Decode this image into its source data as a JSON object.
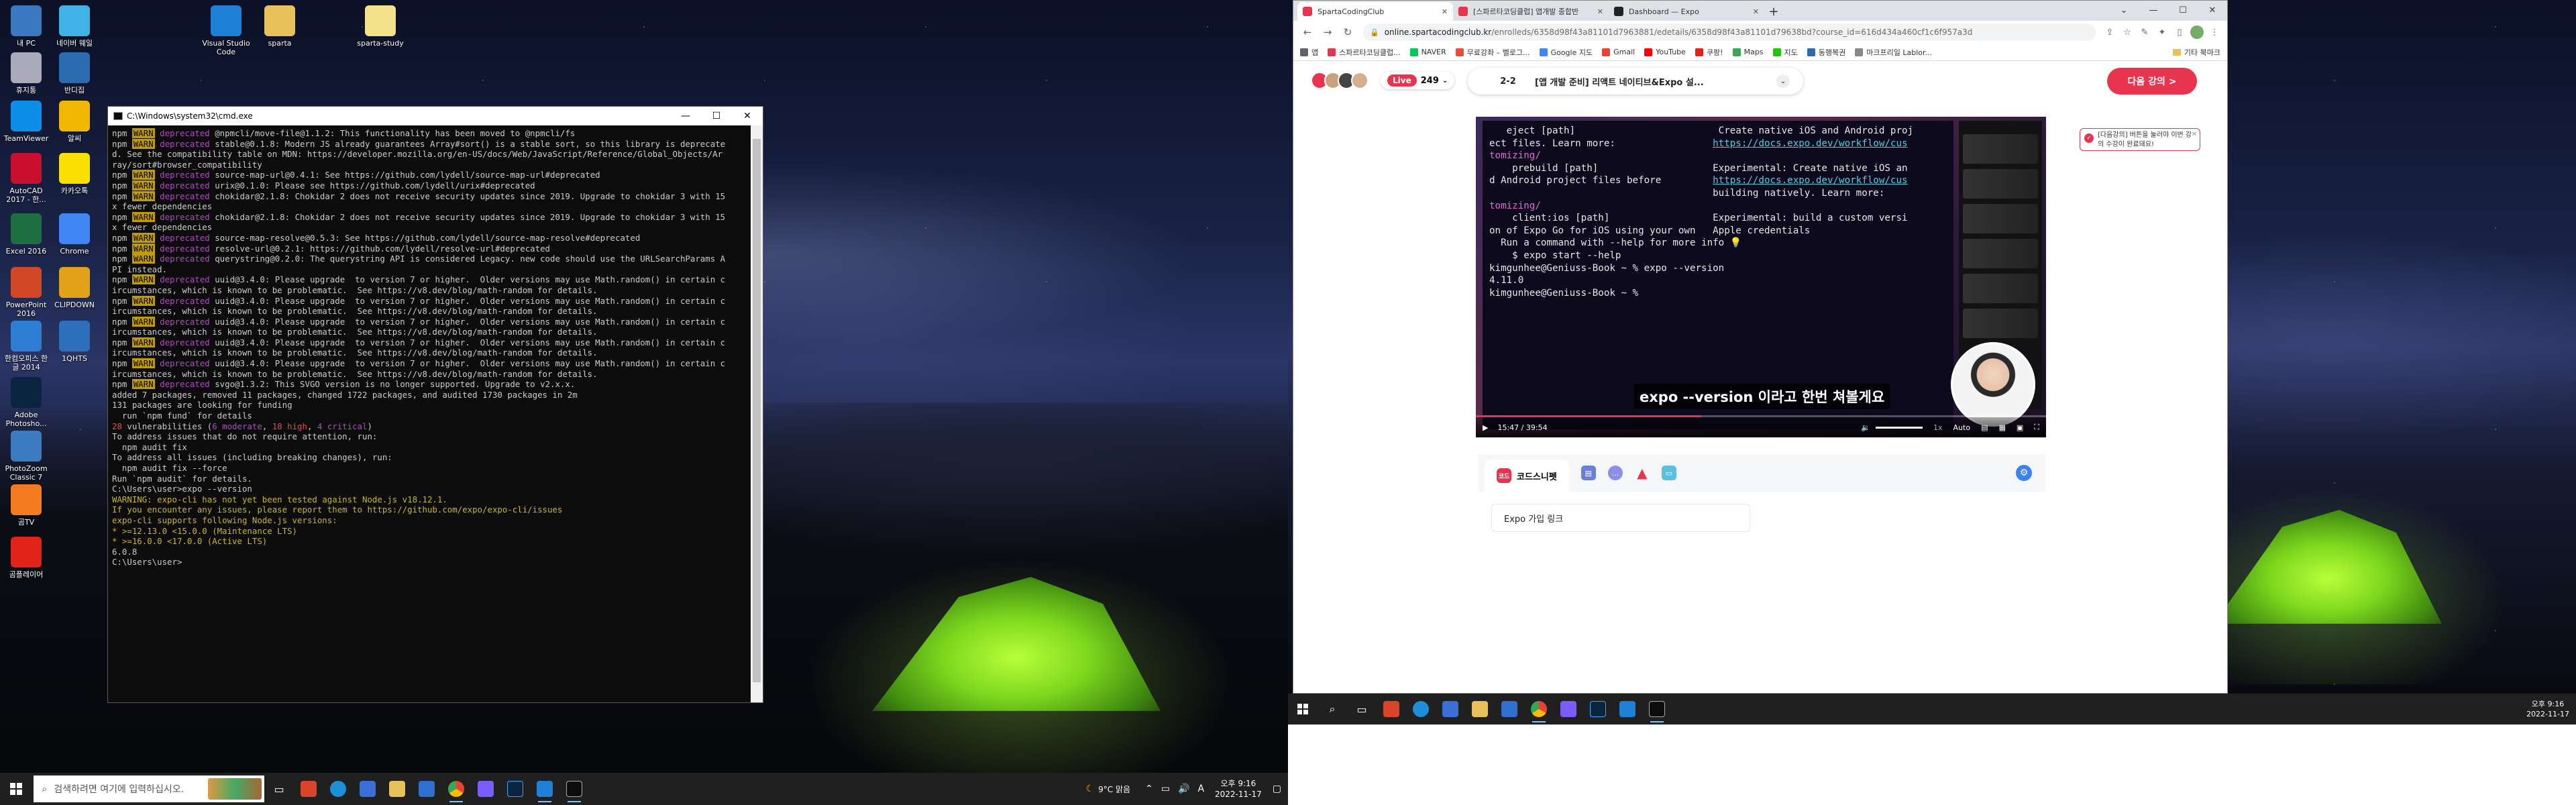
{
  "desktop_icons": [
    {
      "label": "내 PC",
      "icon": "pc-icon",
      "color": "#3a78c2"
    },
    {
      "label": "네이버 웨일",
      "icon": "whale-icon",
      "color": "#3fb3e6"
    },
    {
      "label": "Visual Studio Code",
      "icon": "vscode-icon",
      "color": "#1e7fd6"
    },
    {
      "label": "sparta",
      "icon": "folder-icon",
      "color": "#e8c15a"
    },
    {
      "label": "sparta-study",
      "icon": "file-icon",
      "color": "#f3e28a"
    },
    {
      "label": "휴지통",
      "icon": "recycle-bin-icon",
      "color": "#aab"
    },
    {
      "label": "반디집",
      "icon": "bandizip-icon",
      "color": "#2b6cb0"
    },
    {
      "label": "TeamViewer",
      "icon": "teamviewer-icon",
      "color": "#0e8ee9"
    },
    {
      "label": "알씨",
      "icon": "alsee-icon",
      "color": "#f2b705"
    },
    {
      "label": "AutoCAD 2017 - 한...",
      "icon": "autocad-icon",
      "color": "#c8102e"
    },
    {
      "label": "카카오톡",
      "icon": "kakaotalk-icon",
      "color": "#f9e000"
    },
    {
      "label": "Excel 2016",
      "icon": "excel-icon",
      "color": "#1d6f42"
    },
    {
      "label": "Chrome",
      "icon": "chrome-icon",
      "color": "#4285f4"
    },
    {
      "label": "PowerPoint 2016",
      "icon": "powerpoint-icon",
      "color": "#d24726"
    },
    {
      "label": "CLIPDOWN",
      "icon": "clipdown-icon",
      "color": "#e2a21a"
    },
    {
      "label": "한컴오피스 한글 2014",
      "icon": "hwp-icon",
      "color": "#2d7dd2"
    },
    {
      "label": "1QHTS",
      "icon": "qhts-icon",
      "color": "#2c6fbb"
    },
    {
      "label": "Adobe Photosho...",
      "icon": "photoshop-icon",
      "color": "#0b2540"
    },
    {
      "label": "PhotoZoom Classic 7",
      "icon": "photozoom-icon",
      "color": "#3b7bbf"
    },
    {
      "label": "곰TV",
      "icon": "gomtv-icon",
      "color": "#f47b20"
    },
    {
      "label": "곰플레이어",
      "icon": "gomplayer-icon",
      "color": "#e2231a"
    }
  ],
  "cmd": {
    "title": "C:\\Windows\\system32\\cmd.exe",
    "lines": [
      {
        "t": "npm WARN deprecated @npmcli/move-file@1.1.2: This functionality has been moved to @npmcli/fs",
        "c": "warn"
      },
      {
        "t": "npm WARN deprecated stable@0.1.8: Modern JS already guarantees Array#sort() is a stable sort, so this library is deprecated. See the compatibility table on MDN: https://developer.mozilla.org/en-US/docs/Web/JavaScript/Reference/Global_Objects/Array/sort#browser_compatibility",
        "c": "warn"
      },
      {
        "t": "npm WARN deprecated source-map-url@0.4.1: See https://github.com/lydell/source-map-url#deprecated",
        "c": "warn"
      },
      {
        "t": "npm WARN deprecated urix@0.1.0: Please see https://github.com/lydell/urix#deprecated",
        "c": "warn"
      },
      {
        "t": "npm WARN deprecated chokidar@2.1.8: Chokidar 2 does not receive security updates since 2019. Upgrade to chokidar 3 with 15x fewer dependencies",
        "c": "warn"
      },
      {
        "t": "npm WARN deprecated chokidar@2.1.8: Chokidar 2 does not receive security updates since 2019. Upgrade to chokidar 3 with 15x fewer dependencies",
        "c": "warn"
      },
      {
        "t": "npm WARN deprecated source-map-resolve@0.5.3: See https://github.com/lydell/source-map-resolve#deprecated",
        "c": "warn"
      },
      {
        "t": "npm WARN deprecated resolve-url@0.2.1: https://github.com/lydell/resolve-url#deprecated",
        "c": "warn"
      },
      {
        "t": "npm WARN deprecated querystring@0.2.0: The querystring API is considered Legacy. new code should use the URLSearchParams API instead.",
        "c": "warn"
      },
      {
        "t": "npm WARN deprecated uuid@3.4.0: Please upgrade  to version 7 or higher.  Older versions may use Math.random() in certain circumstances, which is known to be problematic.  See https://v8.dev/blog/math-random for details.",
        "c": "warn"
      },
      {
        "t": "npm WARN deprecated uuid@3.4.0: Please upgrade  to version 7 or higher.  Older versions may use Math.random() in certain circumstances, which is known to be problematic.  See https://v8.dev/blog/math-random for details.",
        "c": "warn"
      },
      {
        "t": "npm WARN deprecated uuid@3.4.0: Please upgrade  to version 7 or higher.  Older versions may use Math.random() in certain circumstances, which is known to be problematic.  See https://v8.dev/blog/math-random for details.",
        "c": "warn"
      },
      {
        "t": "npm WARN deprecated uuid@3.4.0: Please upgrade  to version 7 or higher.  Older versions may use Math.random() in certain circumstances, which is known to be problematic.  See https://v8.dev/blog/math-random for details.",
        "c": "warn"
      },
      {
        "t": "npm WARN deprecated uuid@3.4.0: Please upgrade  to version 7 or higher.  Older versions may use Math.random() in certain circumstances, which is known to be problematic.  See https://v8.dev/blog/math-random for details.",
        "c": "warn"
      },
      {
        "t": "npm WARN deprecated svgo@1.3.2: This SVGO version is no longer supported. Upgrade to v2.x.x.",
        "c": "warn"
      },
      {
        "t": "",
        "c": "plain"
      },
      {
        "t": "added 7 packages, removed 11 packages, changed 1722 packages, and audited 1730 packages in 2m",
        "c": "plain"
      },
      {
        "t": "",
        "c": "plain"
      },
      {
        "t": "131 packages are looking for funding",
        "c": "plain"
      },
      {
        "t": "  run `npm fund` for details",
        "c": "plain"
      },
      {
        "t": "",
        "c": "plain"
      },
      {
        "t": "28 vulnerabilities (6 moderate, 18 high, 4 critical)",
        "c": "vuln"
      },
      {
        "t": "",
        "c": "plain"
      },
      {
        "t": "To address issues that do not require attention, run:",
        "c": "plain"
      },
      {
        "t": "  npm audit fix",
        "c": "plain"
      },
      {
        "t": "",
        "c": "plain"
      },
      {
        "t": "To address all issues (including breaking changes), run:",
        "c": "plain"
      },
      {
        "t": "  npm audit fix --force",
        "c": "plain"
      },
      {
        "t": "",
        "c": "plain"
      },
      {
        "t": "Run `npm audit` for details.",
        "c": "plain"
      },
      {
        "t": "",
        "c": "plain"
      },
      {
        "t": "C:\\Users\\user>expo --version",
        "c": "plain"
      },
      {
        "t": "WARNING: expo-cli has not yet been tested against Node.js v18.12.1.",
        "c": "yellow"
      },
      {
        "t": "If you encounter any issues, please report them to https://github.com/expo/expo-cli/issues",
        "c": "yellow"
      },
      {
        "t": "",
        "c": "plain"
      },
      {
        "t": "expo-cli supports following Node.js versions:",
        "c": "yellow"
      },
      {
        "t": "* >=12.13.0 <15.0.0 (Maintenance LTS)",
        "c": "yellow"
      },
      {
        "t": "* >=16.0.0 <17.0.0 (Active LTS)",
        "c": "yellow"
      },
      {
        "t": "",
        "c": "plain"
      },
      {
        "t": "6.0.8",
        "c": "plain"
      },
      {
        "t": "",
        "c": "plain"
      },
      {
        "t": "C:\\Users\\user>",
        "c": "plain"
      }
    ]
  },
  "taskbar1": {
    "search_placeholder": "검색하려면 여기에 입력하십시오.",
    "weather": "9°C 맑음",
    "time": "오후 9:16",
    "date": "2022-11-17",
    "ime": "A"
  },
  "browser": {
    "tabs": [
      {
        "label": "SpartaCodingClub",
        "color": "#e8344e",
        "active": true
      },
      {
        "label": "[스파르타코딩클럽] 앱개발 종합반",
        "color": "#e8344e",
        "active": false
      },
      {
        "label": "Dashboard — Expo",
        "color": "#222222",
        "active": false
      }
    ],
    "url_host": "online.spartacodingclub.kr",
    "url_path": "/enrolleds/6358d98f43a81101d7963881/edetails/6358d98f43a81101d79638bd?course_id=616d434a460cf1c6f957a3d",
    "bookmarks": [
      {
        "label": "앱",
        "color": "#5f6368"
      },
      {
        "label": "스파르타코딩클럽...",
        "color": "#e8344e"
      },
      {
        "label": "NAVER",
        "color": "#03c75a"
      },
      {
        "label": "무료강좌 – 벨로그...",
        "color": "#e84e3a"
      },
      {
        "label": "Google 지도",
        "color": "#4285f4"
      },
      {
        "label": "Gmail",
        "color": "#ea4335"
      },
      {
        "label": "YouTube",
        "color": "#ff0000"
      },
      {
        "label": "쿠팡!",
        "color": "#e2231a"
      },
      {
        "label": "Maps",
        "color": "#34a853"
      },
      {
        "label": "지도",
        "color": "#1ec800"
      },
      {
        "label": "동행복권",
        "color": "#2b6cb0"
      },
      {
        "label": "마크프리일 Lablor...",
        "color": "#888888"
      }
    ],
    "bookmarks_other": "기타 북마크"
  },
  "page": {
    "live_label": "Live",
    "live_count": "249",
    "lesson_number": "2-2",
    "lesson_title": "[앱 개발 준비] 리액트 네이티브&Expo 설...",
    "next_button": "다음 강의 >",
    "next_tip": "[다음강의] 버튼을 눌러야 이번 강의 수강이 완료돼요!",
    "caption": "expo --version 이라고 한번 쳐볼게요",
    "time_current": "15:47",
    "time_total": "39:54",
    "progress": 0.395,
    "quality": "Auto",
    "speed": "1x",
    "terminal_lines": [
      {
        "t": "   eject [path]                         Create native iOS and Android proj",
        "c": "plain"
      },
      {
        "t": "ect files. Learn more:                 https://docs.expo.dev/workflow/cus",
        "c": "linkline"
      },
      {
        "t": "tomizing/",
        "c": "pink"
      },
      {
        "t": "    prebuild [path]                    Experimental: Create native iOS an",
        "c": "plain"
      },
      {
        "t": "d Android project files before         https://docs.expo.dev/workflow/cus",
        "c": "linkline"
      },
      {
        "t": "                                       building natively. Learn more:",
        "c": "plain"
      },
      {
        "t": "tomizing/",
        "c": "pink"
      },
      {
        "t": "",
        "c": "plain"
      },
      {
        "t": "    client:ios [path]                  Experimental: build a custom versi",
        "c": "plain"
      },
      {
        "t": "on of Expo Go for iOS using your own   Apple credentials",
        "c": "plain"
      },
      {
        "t": "",
        "c": "plain"
      },
      {
        "t": "  Run a command with --help for more info 💡",
        "c": "plain"
      },
      {
        "t": "    $ expo start --help",
        "c": "plain"
      },
      {
        "t": "",
        "c": "plain"
      },
      {
        "t": "kimgunhee@Geniuss-Book ~ % expo --version",
        "c": "plain"
      },
      {
        "t": "4.11.0",
        "c": "plain"
      },
      {
        "t": "kimgunhee@Geniuss-Book ~ % ",
        "c": "plain"
      }
    ],
    "snippet_tab": "코드스니펫",
    "snippet_icon": "코드",
    "snippet_items": [
      "Expo 가입 링크"
    ]
  },
  "taskbar2": {
    "time": "오후 9:16",
    "date": "2022-11-17"
  },
  "colors": {
    "accent": "#e8344e",
    "cmd_warn": "#c19c00",
    "cmd_deprecated": "#b148c6",
    "link_blue": "#3b82f6"
  }
}
